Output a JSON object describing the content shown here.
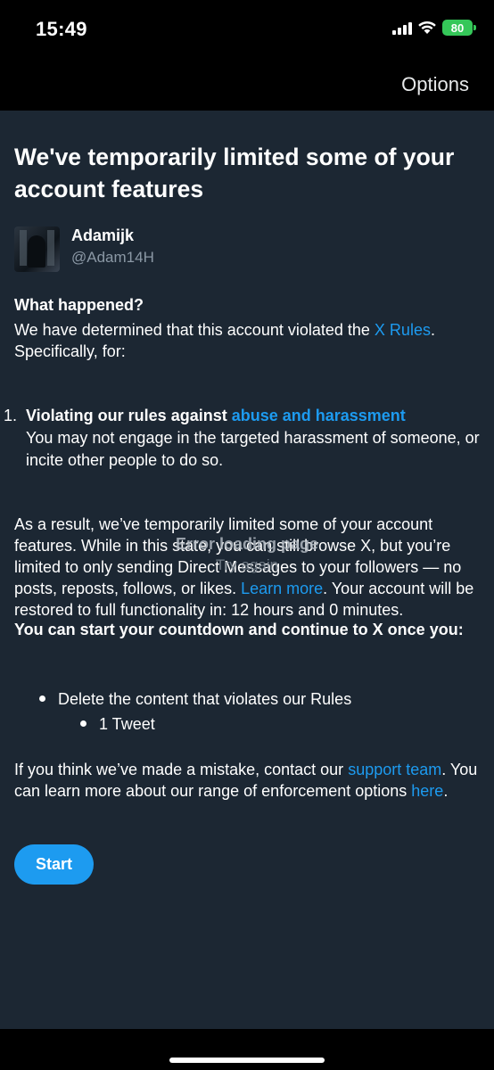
{
  "status_bar": {
    "time": "15:49",
    "battery": "80"
  },
  "nav": {
    "options_label": "Options"
  },
  "page": {
    "title": "We've temporarily limited some of your account features",
    "user": {
      "name": "Adamijk",
      "handle": "@Adam14H"
    },
    "what_happened_heading": "What happened?",
    "intro_text": "We have determined that this account violated the ",
    "x_rules_link": "X Rules",
    "intro_suffix": ".",
    "intro_line2": "Specifically, for:",
    "violation": {
      "number": "1.",
      "title_prefix": "Violating our rules against ",
      "title_link": "abuse and harassment",
      "description": "You may not engage in the targeted harassment of someone, or incite other people to do so."
    },
    "result_text_1": "As a result, we’ve temporarily limited some of your account features. While in this state, you can still browse X, but you’re limited to only sending Direct Messages to your followers — no posts, reposts, follows, or likes. ",
    "learn_more_link": "Learn more",
    "result_text_2": ". Your account will be restored to full functionality in: 12 hours and 0 minutes.",
    "countdown_heading": "You can start your countdown and continue to X once you:",
    "bullet_1": "Delete the content that violates our Rules",
    "bullet_2": "1 Tweet",
    "mistake_text": "If you think we’ve made a mistake, contact our ",
    "support_link": "support team",
    "mistake_text_2": ". You can learn more about our range of enforcement options ",
    "here_link": "here",
    "mistake_suffix": ".",
    "start_button": "Start"
  },
  "overlay": {
    "error_text": "Error loading page",
    "try_again": "Try again"
  },
  "colors": {
    "background": "#1c2733",
    "link": "#1d9bf0",
    "button": "#1d9bf0"
  }
}
